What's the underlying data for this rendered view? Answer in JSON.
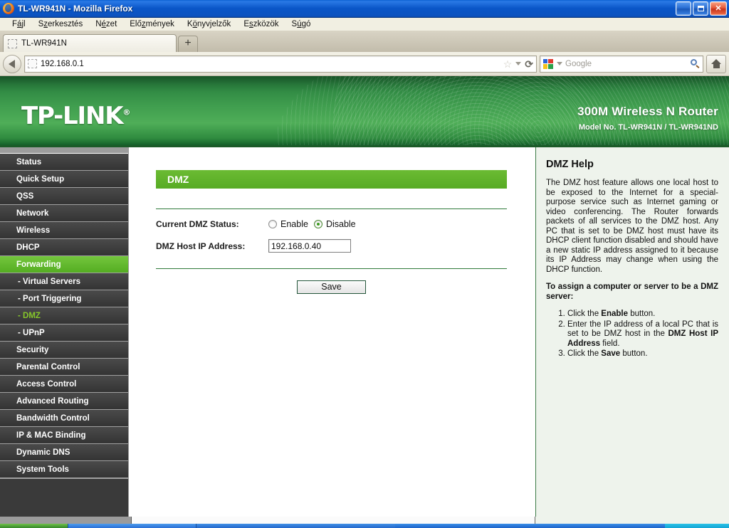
{
  "window": {
    "title": "TL-WR941N - Mozilla Firefox",
    "app_icon": "firefox-icon",
    "minimize_label": "_",
    "maximize_label": "box-glyph",
    "close_label": "✕"
  },
  "menubar": {
    "items": [
      {
        "name": "file",
        "pre": "F",
        "accel": "á",
        "post": "jl"
      },
      {
        "name": "edit",
        "pre": "S",
        "accel": "z",
        "post": "erkesztés"
      },
      {
        "name": "view",
        "pre": "N",
        "accel": "é",
        "post": "zet"
      },
      {
        "name": "history",
        "pre": "Elő",
        "accel": "z",
        "post": "mények"
      },
      {
        "name": "bookmarks",
        "pre": "K",
        "accel": "ö",
        "post": "nyvjelzők"
      },
      {
        "name": "tools",
        "pre": "E",
        "accel": "s",
        "post": "zközök"
      },
      {
        "name": "help",
        "pre": "S",
        "accel": "ú",
        "post": "gó"
      }
    ]
  },
  "tabs": {
    "active_tab_label": "TL-WR941N",
    "new_tab_label": "+"
  },
  "navbar": {
    "back_label": "Back",
    "url_value": "192.168.0.1",
    "star_glyph": "☆",
    "reload_glyph": "⟳",
    "search_placeholder": "Google",
    "search_engine": "Google",
    "home_label": "Home"
  },
  "banner": {
    "brand": "TP-LINK",
    "brand_mark": "®",
    "product": "300M Wireless N Router",
    "model": "Model No. TL-WR941N / TL-WR941ND"
  },
  "sidebar": {
    "items": [
      {
        "label": "Status",
        "state": "normal",
        "sub": false
      },
      {
        "label": "Quick Setup",
        "state": "normal",
        "sub": false
      },
      {
        "label": "QSS",
        "state": "normal",
        "sub": false
      },
      {
        "label": "Network",
        "state": "normal",
        "sub": false
      },
      {
        "label": "Wireless",
        "state": "normal",
        "sub": false
      },
      {
        "label": "DHCP",
        "state": "normal",
        "sub": false
      },
      {
        "label": "Forwarding",
        "state": "active",
        "sub": false
      },
      {
        "label": "- Virtual Servers",
        "state": "normal",
        "sub": true
      },
      {
        "label": "- Port Triggering",
        "state": "normal",
        "sub": true
      },
      {
        "label": "- DMZ",
        "state": "current",
        "sub": true
      },
      {
        "label": "- UPnP",
        "state": "normal",
        "sub": true
      },
      {
        "label": "Security",
        "state": "normal",
        "sub": false
      },
      {
        "label": "Parental Control",
        "state": "normal",
        "sub": false
      },
      {
        "label": "Access Control",
        "state": "normal",
        "sub": false
      },
      {
        "label": "Advanced Routing",
        "state": "normal",
        "sub": false
      },
      {
        "label": "Bandwidth Control",
        "state": "normal",
        "sub": false
      },
      {
        "label": "IP & MAC Binding",
        "state": "normal",
        "sub": false
      },
      {
        "label": "Dynamic DNS",
        "state": "normal",
        "sub": false
      },
      {
        "label": "System Tools",
        "state": "normal",
        "sub": false
      }
    ]
  },
  "main": {
    "section_title": "DMZ",
    "status_label": "Current DMZ Status:",
    "radio_enable": "Enable",
    "radio_disable": "Disable",
    "selected_status": "Disable",
    "ip_label": "DMZ Host IP Address:",
    "ip_value": "192.168.0.40",
    "ip_placeholder": "",
    "save_label": "Save"
  },
  "help": {
    "title": "DMZ Help",
    "paragraph": "The DMZ host feature allows one local host to be exposed to the Internet for a special-purpose service such as Internet gaming or video conferencing. The Router forwards packets of all services to the DMZ host. Any PC that is set to be DMZ host must have its DHCP client function disabled and should have a new static IP address assigned to it because its IP Address may change when using the DHCP function.",
    "subhead": "To assign a computer or server to be a DMZ server:",
    "steps": [
      {
        "pre": "Click the ",
        "bold": "Enable",
        "post": " button."
      },
      {
        "pre": "Enter the IP address of a local PC that is set to be DMZ host in the ",
        "bold": "DMZ Host IP Address",
        "post": " field."
      },
      {
        "pre": "Click the ",
        "bold": "Save",
        "post": " button."
      }
    ]
  },
  "colors": {
    "brand_green": "#5eb32c",
    "banner_green": "#3f9d4e",
    "sidebar_dark": "#3a3a3a",
    "title_blue": "#0a56c8",
    "help_bg": "#eef3ec"
  }
}
